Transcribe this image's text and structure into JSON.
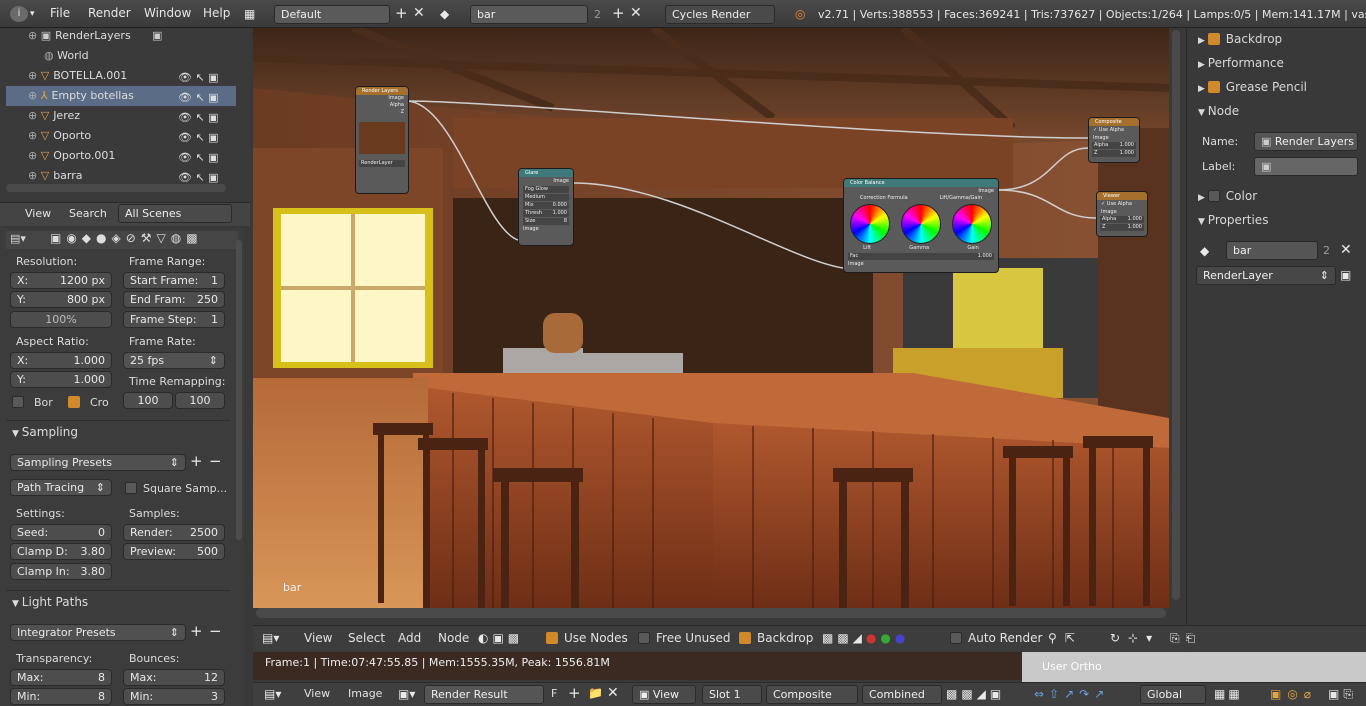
{
  "menu": {
    "file": "File",
    "render": "Render",
    "window": "Window",
    "help": "Help"
  },
  "header": {
    "layout": "Default",
    "scene": "bar",
    "scene_users": "2",
    "engine": "Cycles Render",
    "stats": "v2.71 | Verts:388553 | Faces:369241 | Tris:737627 | Objects:1/264 | Lamps:0/5 | Mem:141.17M | vaso.005"
  },
  "outliner": {
    "items": [
      {
        "label": "RenderLayers"
      },
      {
        "label": "World"
      },
      {
        "label": "BOTELLA.001"
      },
      {
        "label": "Empty botellas"
      },
      {
        "label": "Jerez"
      },
      {
        "label": "Oporto"
      },
      {
        "label": "Oporto.001"
      },
      {
        "label": "barra"
      }
    ],
    "view": "View",
    "search": "Search",
    "filter": "All Scenes"
  },
  "properties": {
    "resolution": "Resolution:",
    "res_x_label": "X:",
    "res_x": "1200 px",
    "res_y_label": "Y:",
    "res_y": "800 px",
    "res_pct": "100%",
    "frame_range": "Frame Range:",
    "start_label": "Start Frame:",
    "start": "1",
    "end_label": "End Fram:",
    "end": "250",
    "step_label": "Frame Step:",
    "step": "1",
    "aspect": "Aspect Ratio:",
    "asp_x_label": "X:",
    "asp_x": "1.000",
    "asp_y_label": "Y:",
    "asp_y": "1.000",
    "frame_rate": "Frame Rate:",
    "fps": "25 fps",
    "time_remap": "Time Remapping:",
    "remap_old": "100",
    "remap_new": "100",
    "border": "Bor",
    "crop": "Cro",
    "sampling": "Sampling",
    "sampling_presets": "Sampling Presets",
    "path_tracing": "Path Tracing",
    "square_samples": "Square Samp...",
    "settings": "Settings:",
    "samples": "Samples:",
    "seed_label": "Seed:",
    "seed": "0",
    "render_label": "Render:",
    "render": "2500",
    "clampd_label": "Clamp D:",
    "clampd": "3.80",
    "preview_label": "Preview:",
    "preview": "500",
    "clampi_label": "Clamp In:",
    "clampi": "3.80",
    "light_paths": "Light Paths",
    "integrator_presets": "Integrator Presets",
    "transparency": "Transparency:",
    "bounces": "Bounces:",
    "t_max_label": "Max:",
    "t_max": "8",
    "b_max_label": "Max:",
    "b_max": "12",
    "t_min_label": "Min:",
    "t_min": "8",
    "b_min_label": "Min:",
    "b_min": "3"
  },
  "viewport": {
    "name": "bar",
    "nodes": {
      "render_layers": "Render Layers",
      "rl_image": "Image",
      "rl_alpha": "Alpha",
      "rl_z": "Z",
      "rl_layer": "RenderLayer",
      "glare": "Glare",
      "glare_image": "Image",
      "glare_type": "Fog Glow",
      "glare_quality": "Medium",
      "glare_mix": "Mix",
      "glare_mix_val": "0.000",
      "glare_thresh": "Thresh",
      "glare_thresh_val": "1.000",
      "glare_size": "Size",
      "glare_size_val": "8",
      "color_balance": "Color Balance",
      "cb_image": "Image",
      "cb_formula": "Correction Formula",
      "cb_lgg": "Lift/Gamma/Gain",
      "cb_lift": "Lift",
      "cb_gamma": "Gamma",
      "cb_gain": "Gain",
      "cb_fac": "Fac",
      "cb_fac_val": "1.000",
      "composite": "Composite",
      "comp_use_alpha": "Use Alpha",
      "comp_image": "Image",
      "comp_alpha": "Alpha",
      "comp_alpha_val": "1.000",
      "comp_z": "Z",
      "comp_z_val": "1.000",
      "viewer": "Viewer",
      "v_use_alpha": "Use Alpha",
      "v_image": "Image",
      "v_alpha": "Alpha",
      "v_alpha_val": "1.000",
      "v_z": "Z",
      "v_z_val": "1.000"
    }
  },
  "right": {
    "backdrop": "Backdrop",
    "performance": "Performance",
    "grease_pencil": "Grease Pencil",
    "node": "Node",
    "name_label": "Name:",
    "name_val": "Render Layers",
    "label_label": "Label:",
    "color": "Color",
    "props": "Properties",
    "scene": "bar",
    "scene_users": "2",
    "render_layer": "RenderLayer"
  },
  "nodebar": {
    "view": "View",
    "select": "Select",
    "add": "Add",
    "node": "Node",
    "use_nodes": "Use Nodes",
    "free_unused": "Free Unused",
    "backdrop": "Backdrop",
    "auto_render": "Auto Render"
  },
  "status": {
    "text": "Frame:1 | Time:07:47:55.85 | Mem:1555.35M, Peak: 1556.81M",
    "ortho": "User Ortho"
  },
  "bottom": {
    "view": "View",
    "image": "Image",
    "render_result": "Render Result",
    "f": "F",
    "view2": "View",
    "slot": "Slot 1",
    "composite": "Composite",
    "combined": "Combined",
    "global": "Global"
  },
  "colors": {
    "accent": "#d08a2c",
    "selection": "#5b6d86"
  }
}
